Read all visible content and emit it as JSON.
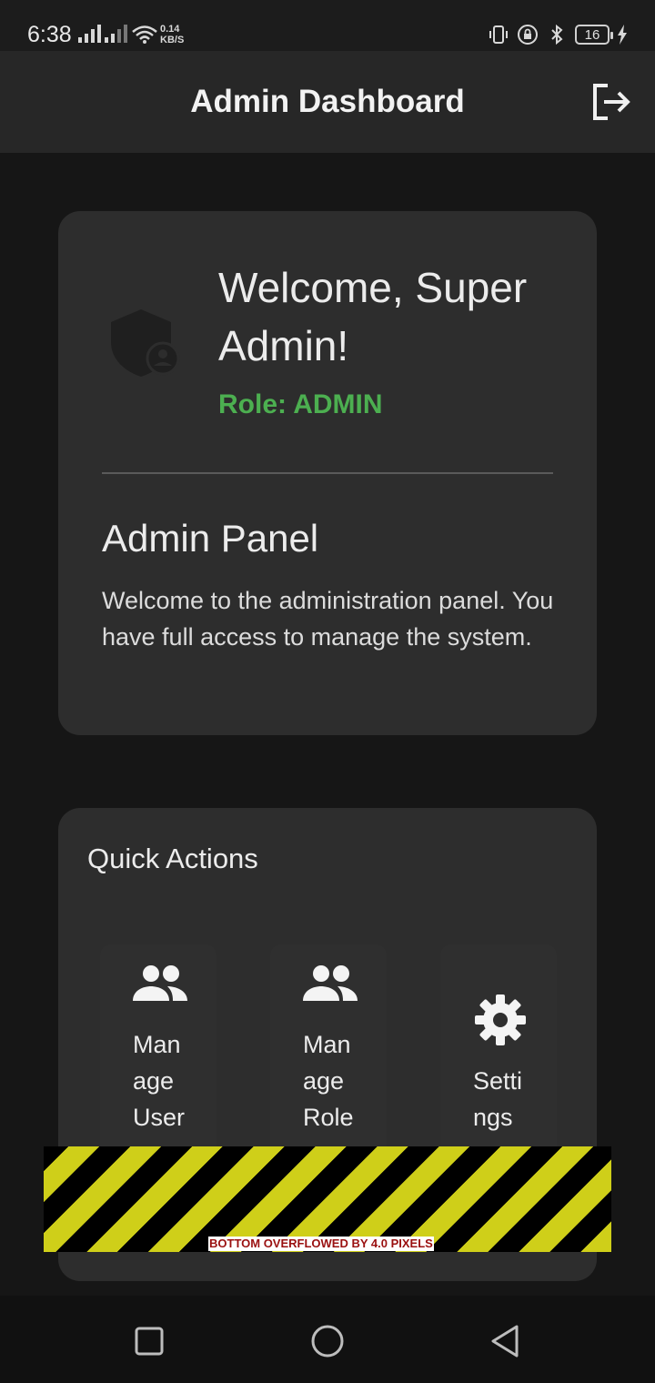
{
  "status_bar": {
    "time": "6:38",
    "net_speed_value": "0.14",
    "net_speed_unit": "KB/S",
    "battery": "16"
  },
  "app_bar": {
    "title": "Admin Dashboard",
    "logout_icon": "logout-icon"
  },
  "welcome_card": {
    "icon": "admin-shield-icon",
    "greeting": "Welcome, Super Admin!",
    "role": "Role: ADMIN",
    "panel_title": "Admin Panel",
    "panel_description": "Welcome to the administration panel. You have full access to manage the system."
  },
  "quick_actions": {
    "title": "Quick Actions",
    "items": [
      {
        "label": "Manage Users",
        "icon": "people-icon"
      },
      {
        "label": "Manage Roles",
        "icon": "people-icon"
      },
      {
        "label": "Settings",
        "icon": "gear-icon"
      }
    ]
  },
  "overflow_warning": "BOTTOM OVERFLOWED BY 4.0 PIXELS",
  "colors": {
    "background": "#161616",
    "app_bar": "#272727",
    "card": "#2d2d2d",
    "role_accent": "#4caf50"
  }
}
